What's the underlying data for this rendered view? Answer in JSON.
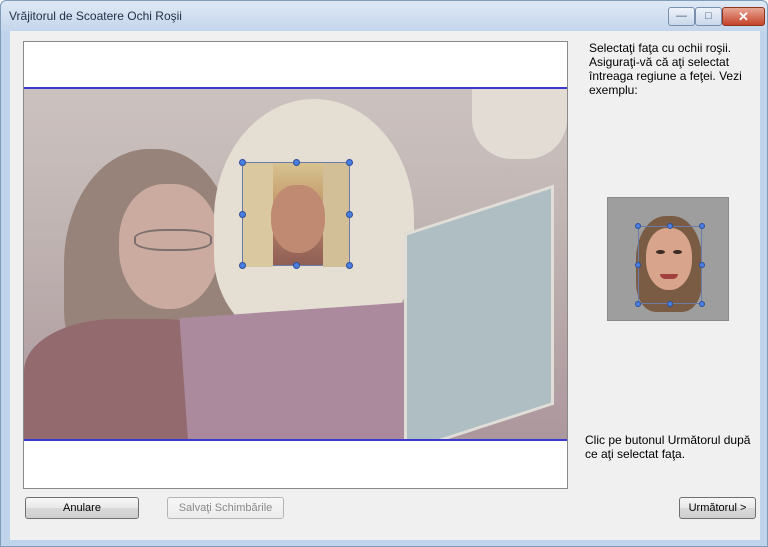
{
  "window": {
    "title": "Vrăjitorul de Scoatere Ochi Roşii",
    "minimize_glyph": "—",
    "maximize_glyph": "□",
    "close_glyph": "✕"
  },
  "instructions": {
    "top": "Selectaţi faţa cu ochii roşii. Asiguraţi-vă că aţi selectat întreaga regiune a feţei. Vezi exemplu:",
    "bottom": "Clic pe butonul Următorul după ce aţi selectat faţa."
  },
  "buttons": {
    "cancel": "Anulare",
    "save": "Salvaţi Schimbările",
    "next": "Următorul >"
  },
  "colors": {
    "selection_handle": "#4a7ee0",
    "photo_band_border": "#3a3ad0",
    "close_button": "#c4432a"
  },
  "icons": {
    "minimize": "minimize-icon",
    "maximize": "maximize-icon",
    "close": "close-icon"
  }
}
